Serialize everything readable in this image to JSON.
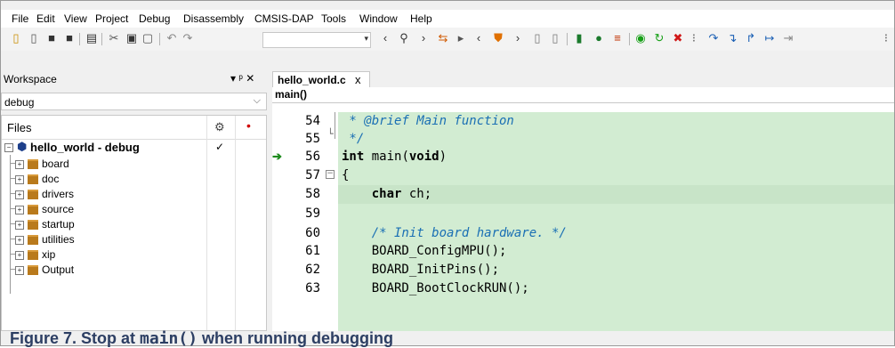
{
  "menu": [
    "File",
    "Edit",
    "View",
    "Project",
    "Debug",
    "Disassembly",
    "CMSIS-DAP",
    "Tools",
    "Window",
    "Help"
  ],
  "workspace": {
    "title": "Workspace",
    "pin": "▾ ᵖ ✕",
    "config": "debug",
    "files_header": "Files",
    "project": "hello_world - debug",
    "project_check": "✓",
    "items": [
      "board",
      "doc",
      "drivers",
      "source",
      "startup",
      "utilities",
      "xip",
      "Output"
    ]
  },
  "editor": {
    "tab_label": "hello_world.c",
    "tab_close": "x",
    "function": "main()",
    "lines": [
      {
        "num": "54",
        "text": " * @brief Main function"
      },
      {
        "num": "55",
        "text": " */"
      },
      {
        "num": "56",
        "text": "int main(void)"
      },
      {
        "num": "57",
        "text": "{"
      },
      {
        "num": "58",
        "text": "    char ch;"
      },
      {
        "num": "59",
        "text": ""
      },
      {
        "num": "60",
        "text": "    /* Init board hardware. */"
      },
      {
        "num": "61",
        "text": "    BOARD_ConfigMPU();"
      },
      {
        "num": "62",
        "text": "    BOARD_InitPins();"
      },
      {
        "num": "63",
        "text": "    BOARD_BootClockRUN();"
      }
    ]
  },
  "caption": {
    "prefix": "Figure 7.  Stop at ",
    "code": "main()",
    "suffix": " when running debugging"
  },
  "colors": {
    "code_bg": "#d2ecd2",
    "comment": "#1a6fb4",
    "caption": "#2c3e63"
  }
}
